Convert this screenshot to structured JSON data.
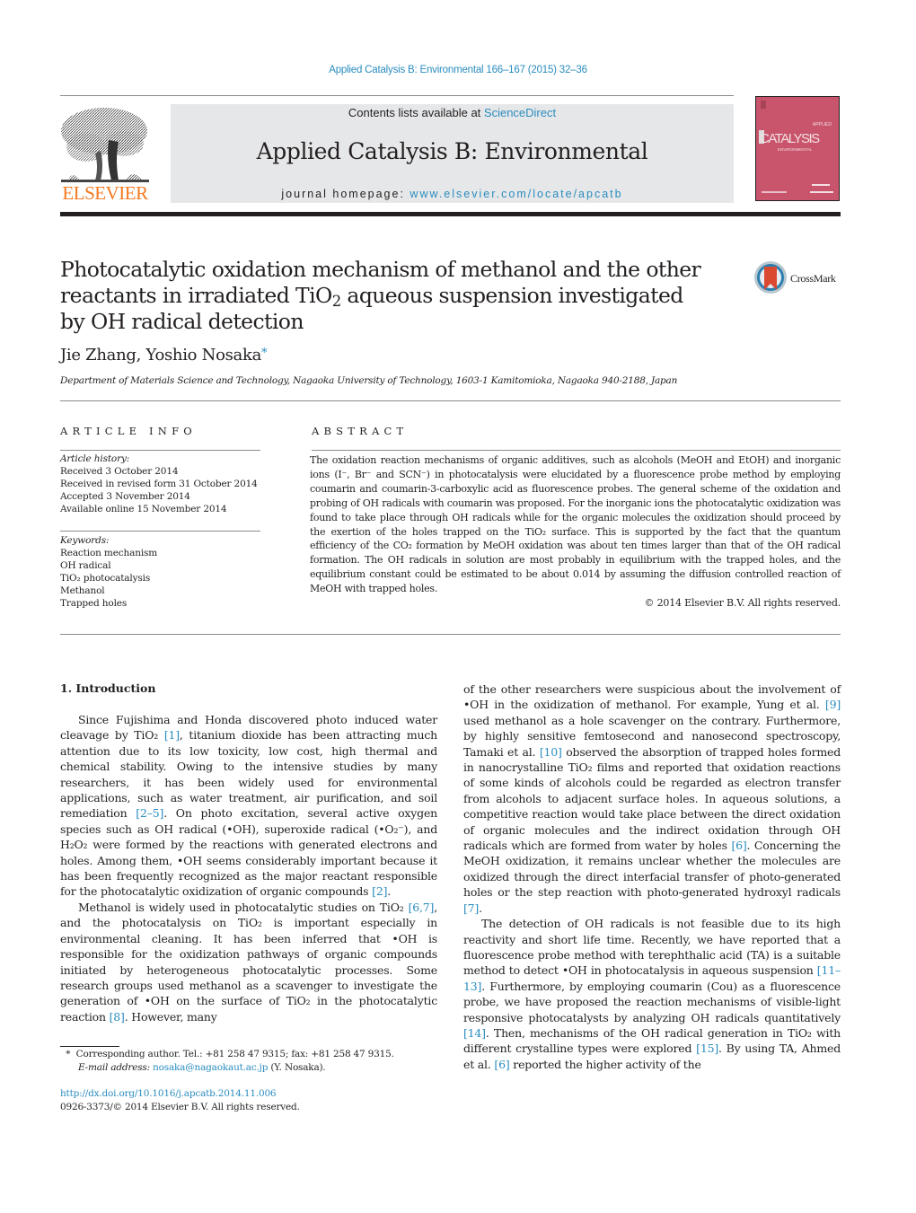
{
  "header": {
    "journal_ref": "Applied Catalysis B: Environmental 166–167 (2015) 32–36",
    "contents_prefix": "Contents lists available at ",
    "contents_link": "ScienceDirect",
    "journal_title": "Applied Catalysis B: Environmental",
    "homepage_prefix": "journal homepage: ",
    "homepage_link": "www.elsevier.com/locate/apcatb",
    "publisher_logo_text": "ELSEVIER",
    "cover": {
      "top_text": "APPLIED",
      "title": "CATALYSIS",
      "subtitle": "ENVIRONMENTAL",
      "color": "#c8556b"
    }
  },
  "article": {
    "title_part1": "Photocatalytic oxidation mechanism of methanol and the other reactants in irradiated TiO",
    "title_sub": "2",
    "title_part2": " aqueous suspension investigated by OH radical detection",
    "crossmark_label": "CrossMark",
    "authors": "Jie Zhang, Yoshio Nosaka",
    "author_mark": "*",
    "affiliation": "Department of Materials Science and Technology, Nagaoka University of Technology, 1603-1 Kamitomioka, Nagaoka 940-2188, Japan"
  },
  "article_info": {
    "heading": "ARTICLE INFO",
    "history_label": "Article history:",
    "history": [
      "Received 3 October 2014",
      "Received in revised form 31 October 2014",
      "Accepted 3 November 2014",
      "Available online 15 November 2014"
    ],
    "keywords_label": "Keywords:",
    "keywords": [
      "Reaction mechanism",
      "OH radical",
      "TiO₂ photocatalysis",
      "Methanol",
      "Trapped holes"
    ]
  },
  "abstract": {
    "heading": "ABSTRACT",
    "text": "The oxidation reaction mechanisms of organic additives, such as alcohols (MeOH and EtOH) and inorganic ions (I⁻, Br⁻ and SCN⁻) in photocatalysis were elucidated by a fluorescence probe method by employing coumarin and coumarin-3-carboxylic acid as fluorescence probes. The general scheme of the oxidation and probing of OH radicals with coumarin was proposed. For the inorganic ions the photocatalytic oxidization was found to take place through OH radicals while for the organic molecules the oxidization should proceed by the exertion of the holes trapped on the TiO₂ surface. This is supported by the fact that the quantum efficiency of the CO₂ formation by MeOH oxidation was about ten times larger than that of the OH radical formation. The OH radicals in solution are most probably in equilibrium with the trapped holes, and the equilibrium constant could be estimated to be about 0.014 by assuming the diffusion controlled reaction of MeOH with trapped holes.",
    "copyright": "© 2014 Elsevier B.V. All rights reserved."
  },
  "body": {
    "section_heading": "1.  Introduction",
    "paragraphs": [
      [
        {
          "t": "Since Fujishima and Honda discovered photo induced water cleavage by TiO₂ "
        },
        {
          "ref": "[1]"
        },
        {
          "t": ", titanium dioxide has been attracting much attention due to its low toxicity, low cost, high thermal and chemical stability. Owing to the intensive studies by many researchers, it has been widely used for environmental applications, such as water treatment, air purification, and soil remediation "
        },
        {
          "ref": "[2–5]"
        },
        {
          "t": ". On photo excitation, several active oxygen species such as OH radical (•OH), superoxide radical (•O₂⁻), and H₂O₂ were formed by the reactions with generated electrons and holes. Among them, •OH seems considerably important because it has been frequently recognized as the major reactant responsible for the photocatalytic oxidization of organic compounds "
        },
        {
          "ref": "[2]"
        },
        {
          "t": "."
        }
      ],
      [
        {
          "t": "Methanol is widely used in photocatalytic studies on TiO₂ "
        },
        {
          "ref": "[6,7]"
        },
        {
          "t": ", and the photocatalysis on TiO₂ is important especially in environmental cleaning. It has been inferred that •OH is responsible for the oxidization pathways of organic compounds initiated by heterogeneous photocatalytic processes. Some research groups used methanol as a scavenger to investigate the generation of •OH on the surface of TiO₂ in the photocatalytic reaction "
        },
        {
          "ref": "[8]"
        },
        {
          "t": ". However, many of the other researchers were suspicious about the involvement of •OH in the oxidization of methanol. For example, Yung et al. "
        },
        {
          "ref": "[9]"
        },
        {
          "t": " used methanol as a hole scavenger on the contrary. Furthermore, by highly sensitive femtosecond and nanosecond spectroscopy, Tamaki et al. "
        },
        {
          "ref": "[10]"
        },
        {
          "t": " observed the absorption of trapped holes formed in nanocrystalline TiO₂ films and reported that oxidation reactions of some kinds of alcohols could be regarded as electron transfer from alcohols to adjacent surface holes. In aqueous solutions, a competitive reaction would take place between the direct oxidation of organic molecules and the indirect oxidation through OH radicals which are formed from water by holes "
        },
        {
          "ref": "[6]"
        },
        {
          "t": ". Concerning the MeOH oxidization, it remains unclear whether the molecules are oxidized through the direct interfacial transfer of photo-generated holes or the step reaction with photo-generated hydroxyl radicals "
        },
        {
          "ref": "[7]"
        },
        {
          "t": "."
        }
      ],
      [
        {
          "t": "The detection of OH radicals is not feasible due to its high reactivity and short life time. Recently, we have reported that a fluorescence probe method with terephthalic acid (TA) is a suitable method to detect •OH in photocatalysis in aqueous suspension "
        },
        {
          "ref": "[11–13]"
        },
        {
          "t": ". Furthermore, by employing coumarin (Cou) as a fluorescence probe, we have proposed the reaction mechanisms of visible-light responsive photocatalysts by analyzing OH radicals quantitatively "
        },
        {
          "ref": "[14]"
        },
        {
          "t": ". Then, mechanisms of the OH radical generation in TiO₂ with different crystalline types were explored "
        },
        {
          "ref": "[15]"
        },
        {
          "t": ". By using TA, Ahmed et al. "
        },
        {
          "ref": "[6]"
        },
        {
          "t": " reported the higher activity of the"
        }
      ]
    ]
  },
  "footnote": {
    "mark": "*",
    "corresponding": "Corresponding author. Tel.: +81 258 47 9315; fax: +81 258 47 9315.",
    "email_label": "E-mail address: ",
    "email": "nosaka@nagaokaut.ac.jp",
    "email_suffix": " (Y. Nosaka).",
    "doi": "http://dx.doi.org/10.1016/j.apcatb.2014.11.006",
    "issn_copyright": "0926-3373/© 2014 Elsevier B.V. All rights reserved."
  },
  "colors": {
    "link": "#2a8cbf",
    "elsevier_orange": "#f47920",
    "banner_bg": "#e6e7e8"
  }
}
